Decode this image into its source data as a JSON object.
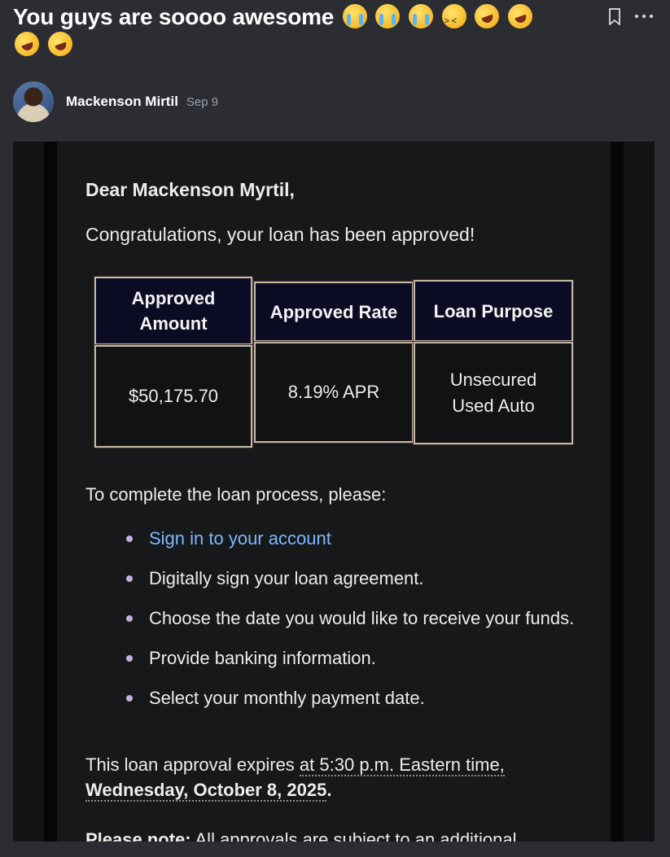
{
  "post": {
    "title": "You guys are soooo awesome",
    "title_emojis": [
      "loudly-crying-face",
      "loudly-crying-face",
      "loudly-crying-face",
      "tired-face",
      "rolling-on-the-floor-laughing",
      "rolling-on-the-floor-laughing",
      "rolling-on-the-floor-laughing",
      "rolling-on-the-floor-laughing"
    ],
    "author": "Mackenson Mirtil",
    "date": "Sep 9",
    "actions": {
      "bookmark_icon": "bookmark-icon",
      "more_icon": "more-horizontal-icon"
    }
  },
  "email": {
    "greeting": "Dear Mackenson Myrtil,",
    "congrats": "Congratulations, your loan has been approved!",
    "table": {
      "headers": [
        "Approved Amount",
        "Approved Rate",
        "Loan Purpose"
      ],
      "values": [
        "$50,175.70",
        "8.19% APR",
        "Unsecured Used Auto"
      ]
    },
    "steps_intro": "To complete the loan process, please:",
    "steps": [
      "Sign in to your account",
      "Digitally sign your loan agreement.",
      "Choose the date you would like to receive your funds.",
      "Provide banking information.",
      "Select your monthly payment date."
    ],
    "expiry_prefix": "This loan approval expires ",
    "expiry_time": "at 5:30 p.m. Eastern time,",
    "expiry_date": "Wednesday, October 8, 2025",
    "expiry_suffix": ".",
    "note_label": "Please note:",
    "note_text": " All approvals are subject to an additional"
  },
  "colors": {
    "page_bg": "#2b2d33",
    "email_bg": "#16181a",
    "link": "#7db8ff",
    "table_header_bg": "#0b0b24",
    "bullet": "#c7aee0"
  }
}
